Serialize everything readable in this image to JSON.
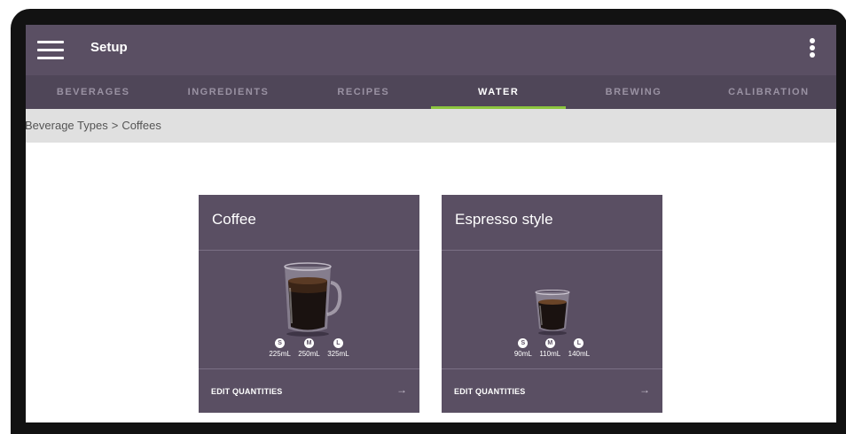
{
  "appbar": {
    "title": "Setup"
  },
  "tabs": [
    {
      "label": "BEVERAGES",
      "active": false
    },
    {
      "label": "INGREDIENTS",
      "active": false
    },
    {
      "label": "RECIPES",
      "active": false
    },
    {
      "label": "WATER",
      "active": true
    },
    {
      "label": "BREWING",
      "active": false
    },
    {
      "label": "CALIBRATION",
      "active": false
    }
  ],
  "breadcrumb": {
    "parent": "Beverage Types",
    "separator": ">",
    "current": "Coffees"
  },
  "cards": [
    {
      "title": "Coffee",
      "sizes": [
        {
          "badge": "S",
          "quantity": "225mL"
        },
        {
          "badge": "M",
          "quantity": "250mL"
        },
        {
          "badge": "L",
          "quantity": "325mL"
        }
      ],
      "action": "EDIT QUANTITIES",
      "arrow": "→"
    },
    {
      "title": "Espresso style",
      "sizes": [
        {
          "badge": "S",
          "quantity": "90mL"
        },
        {
          "badge": "M",
          "quantity": "110mL"
        },
        {
          "badge": "L",
          "quantity": "140mL"
        }
      ],
      "action": "EDIT QUANTITIES",
      "arrow": "→"
    }
  ],
  "colors": {
    "appbar": "#5a4f63",
    "tabbar": "#4f4658",
    "active_indicator": "#8cc63f",
    "breadcrumb_bg": "#e0e0e0"
  }
}
